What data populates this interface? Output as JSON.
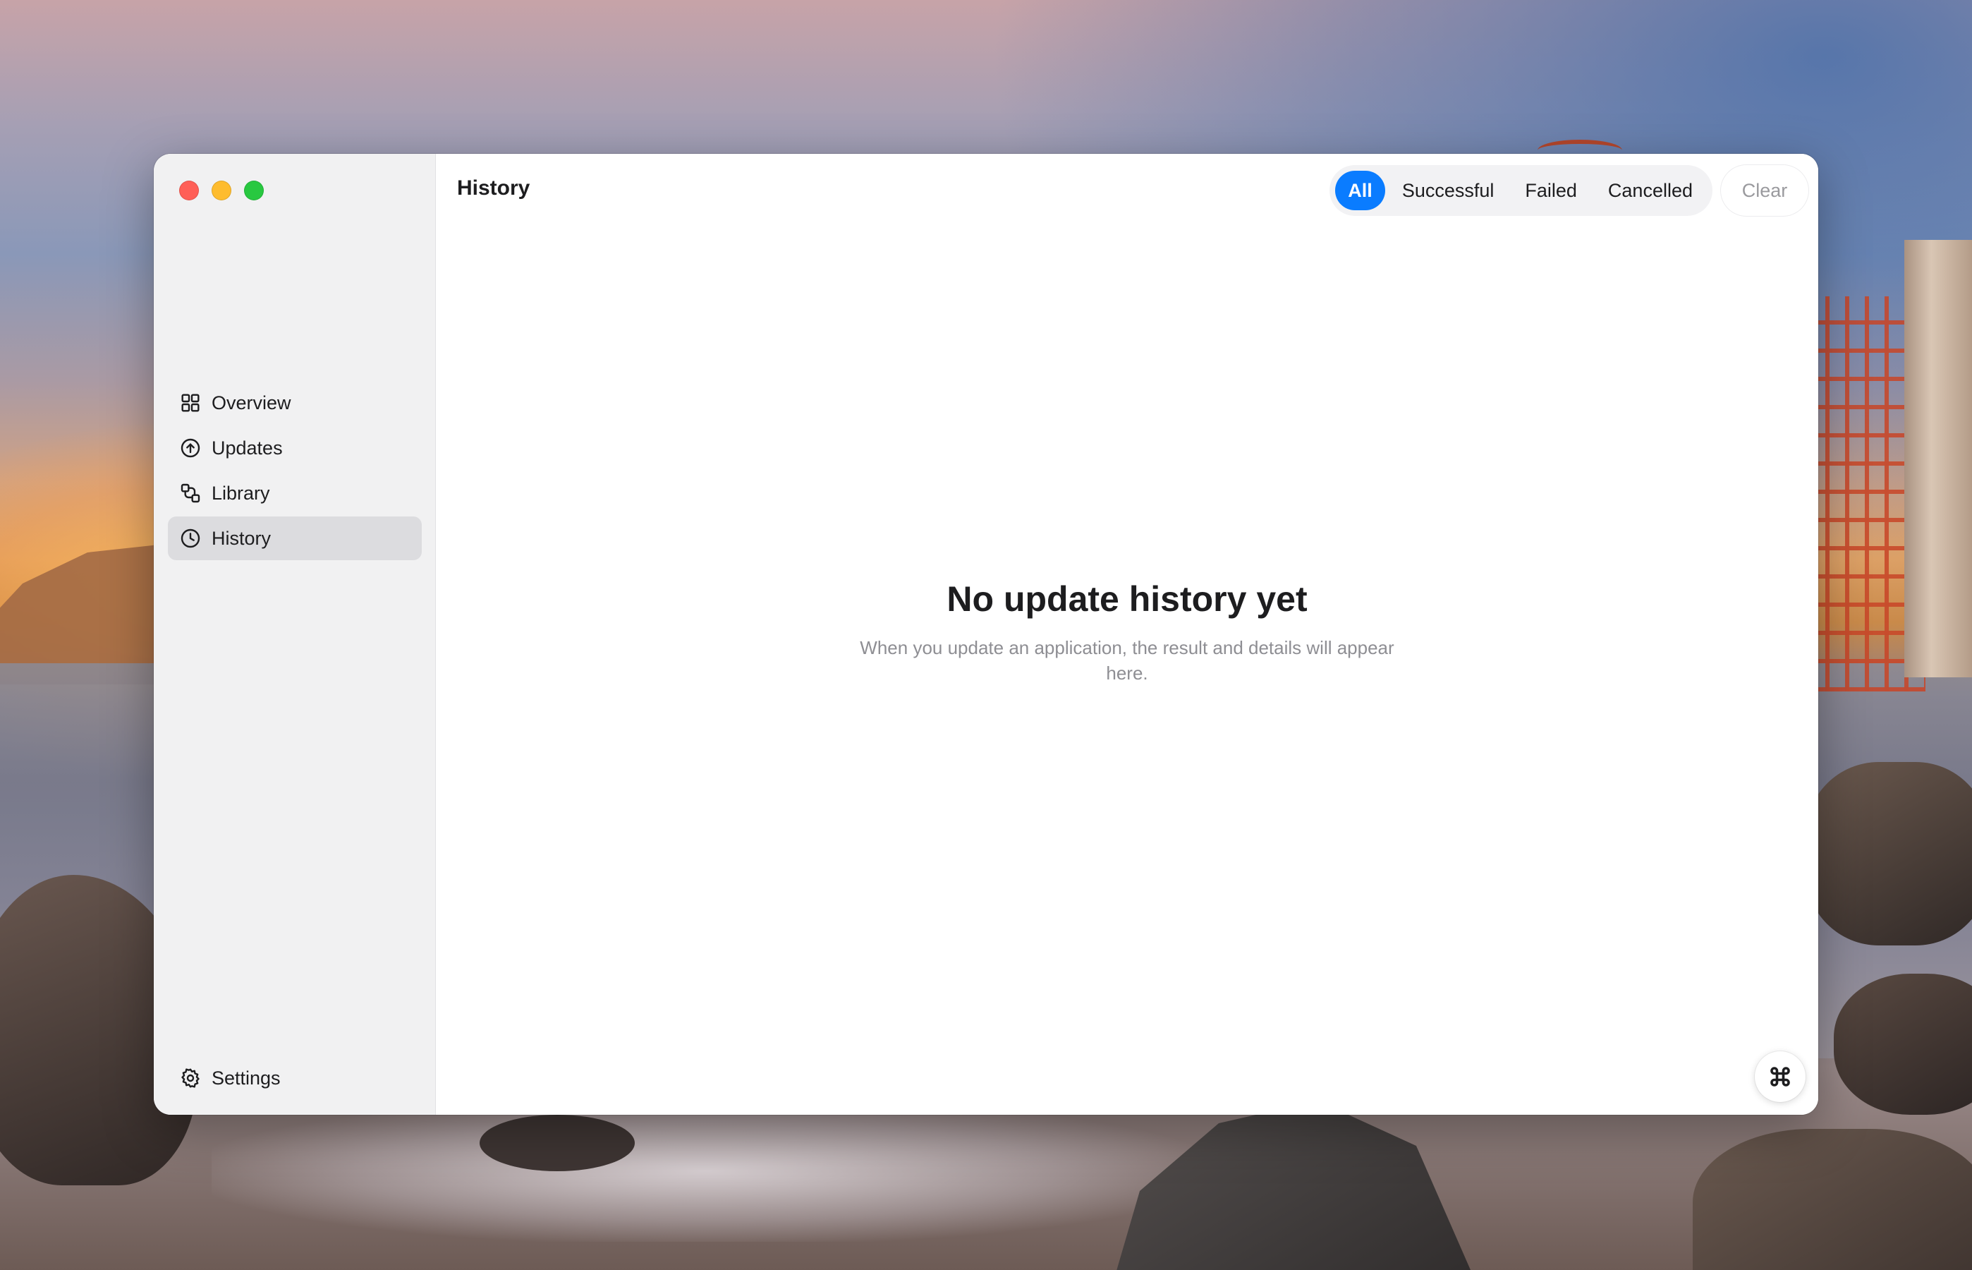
{
  "window": {
    "traffic_lights": [
      "close",
      "minimize",
      "zoom"
    ]
  },
  "sidebar": {
    "items": [
      {
        "label": "Overview",
        "icon": "grid-icon",
        "active": false
      },
      {
        "label": "Updates",
        "icon": "arrow-up-circle-icon",
        "active": false
      },
      {
        "label": "Library",
        "icon": "library-icon",
        "active": false
      },
      {
        "label": "History",
        "icon": "clock-icon",
        "active": true
      }
    ],
    "settings": {
      "label": "Settings",
      "icon": "gear-icon"
    }
  },
  "header": {
    "title": "History",
    "filters": [
      {
        "label": "All",
        "active": true
      },
      {
        "label": "Successful",
        "active": false
      },
      {
        "label": "Failed",
        "active": false
      },
      {
        "label": "Cancelled",
        "active": false
      }
    ],
    "clear_label": "Clear"
  },
  "empty_state": {
    "title": "No update history yet",
    "subtitle": "When you update an application, the result and details will appear here."
  },
  "floating_button": {
    "icon": "command-icon"
  },
  "colors": {
    "accent": "#0a7cff",
    "sidebar_bg": "#f1f1f2",
    "active_item_bg": "#dcdcdf",
    "traffic_close": "#ff5f57",
    "traffic_minimize": "#febc2e",
    "traffic_zoom": "#28c840"
  }
}
